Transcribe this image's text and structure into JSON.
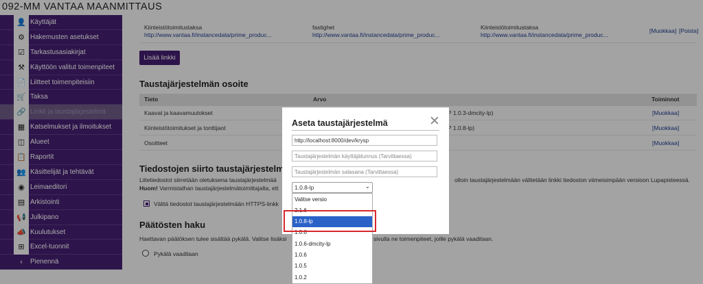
{
  "app_title": "092-MM VANTAA MAANMITTAUS",
  "sidebar": {
    "items": [
      {
        "label": "Käyttäjät",
        "icon": "person-icon",
        "glyph": "👤"
      },
      {
        "label": "Hakemusten asetukset",
        "icon": "gear-icon",
        "glyph": "⚙"
      },
      {
        "label": "Tarkastusasiakirjat",
        "icon": "checklist-icon",
        "glyph": "☑"
      },
      {
        "label": "Käyttöön valitut toimenpiteet",
        "icon": "hammer-icon",
        "glyph": "⚒"
      },
      {
        "label": "Liitteet toimenpiteisiin",
        "icon": "attachment-icon",
        "glyph": "📄"
      },
      {
        "label": "Taksa",
        "icon": "cart-icon",
        "glyph": "🛒"
      },
      {
        "label": "Linkit ja taustajärjestelmä",
        "icon": "link-icon",
        "glyph": "🔗"
      },
      {
        "label": "Katselmukset ja ilmoitukset",
        "icon": "calendar-icon",
        "glyph": "▦"
      },
      {
        "label": "Alueet",
        "icon": "area-icon",
        "glyph": "◫"
      },
      {
        "label": "Raportit",
        "icon": "report-icon",
        "glyph": "📋"
      },
      {
        "label": "Käsittelijät ja tehtävät",
        "icon": "people-icon",
        "glyph": "👥"
      },
      {
        "label": "Leimaeditori",
        "icon": "stamp-icon",
        "glyph": "◉"
      },
      {
        "label": "Arkistointi",
        "icon": "archive-icon",
        "glyph": "▤"
      },
      {
        "label": "Julkipano",
        "icon": "megaphone-icon",
        "glyph": "📢"
      },
      {
        "label": "Kuulutukset",
        "icon": "announcement-icon",
        "glyph": "📣"
      },
      {
        "label": "Excel-tuonnit",
        "icon": "excel-icon",
        "glyph": "⊞"
      },
      {
        "label": "Pienennä",
        "icon": "chevron-left-icon",
        "glyph": "‹"
      }
    ],
    "active_index": 6
  },
  "links_table": {
    "row": {
      "fi_name": "Kiinteistötoimitustaksa",
      "fi_url": "http://www.vantaa.fi/instancedata/prime_produc...",
      "sv_name": "fastighet",
      "sv_url": "http://www.vantaa.fi/instancedata/prime_produc...",
      "en_name": "Kiinteistötoimitustaksa",
      "en_url": "http://www.vantaa.fi/instancedata/prime_produc...",
      "edit": "[Muokkaa]",
      "delete": "[Poista]"
    },
    "add_button": "Lisää linkki"
  },
  "backend": {
    "heading": "Taustajärjestelmän osoite",
    "columns": [
      "Tieto",
      "Arvo",
      "Toiminnot"
    ],
    "rows": [
      {
        "tieto": "Kaavat ja kaavamuutokset",
        "arvo_tail": "P 1.0.3-dmcity-lp)",
        "action": "[Muokkaa]"
      },
      {
        "tieto": "Kiinteistötoimitukset ja tonttijaot",
        "arvo_tail": "P 1.0.8-lp)",
        "action": "[Muokkaa]"
      },
      {
        "tieto": "Osoitteet",
        "arvo_tail": "",
        "action": "[Muokkaa]"
      }
    ]
  },
  "transfer": {
    "heading": "Tiedostojen siirto taustajärjestelmää",
    "line1_left": "Liitetiedostot siirretään oletuksena taustajärjestelmää",
    "line1_right": "olloin taustajärjestelmään välitetään linkki tiedoston viimeisimpään versioon Lupapisteessä.",
    "line2_bold": "Huom!",
    "line2_text": " Varmistathan taustajärjestelmätoimittajalta, ett",
    "checkbox_label": "Välitä tiedostot taustajärjestelmään HTTPS-linkk"
  },
  "decisions": {
    "heading": "Päätösten haku",
    "text_left": "Haettavan päätöksen tulee sisältää pykälä. Valitse lisäksi",
    "text_right": "sivulla ne toimenpiteet, joille pykälä vaaditaan.",
    "radio_label": "Pykälä vaaditaan"
  },
  "modal": {
    "title": "Aseta taustajärjestelmä",
    "url_value": "http://localhost:8000/dev/krysp",
    "username_placeholder": "Taustajärjestelmän käyttäjätunnus (Tarvittaessa)",
    "password_placeholder": "Taustajärjestelmän salasana (Tarvittaessa)",
    "selected_version": "1.0.8-lp",
    "options": [
      "Valitse versio",
      "2.1.6",
      "1.0.8-lp",
      "1.0.6",
      "1.0.6-dmcity-lp",
      "1.0.6",
      "1.0.5",
      "1.0.2"
    ],
    "highlighted_index": 2
  }
}
